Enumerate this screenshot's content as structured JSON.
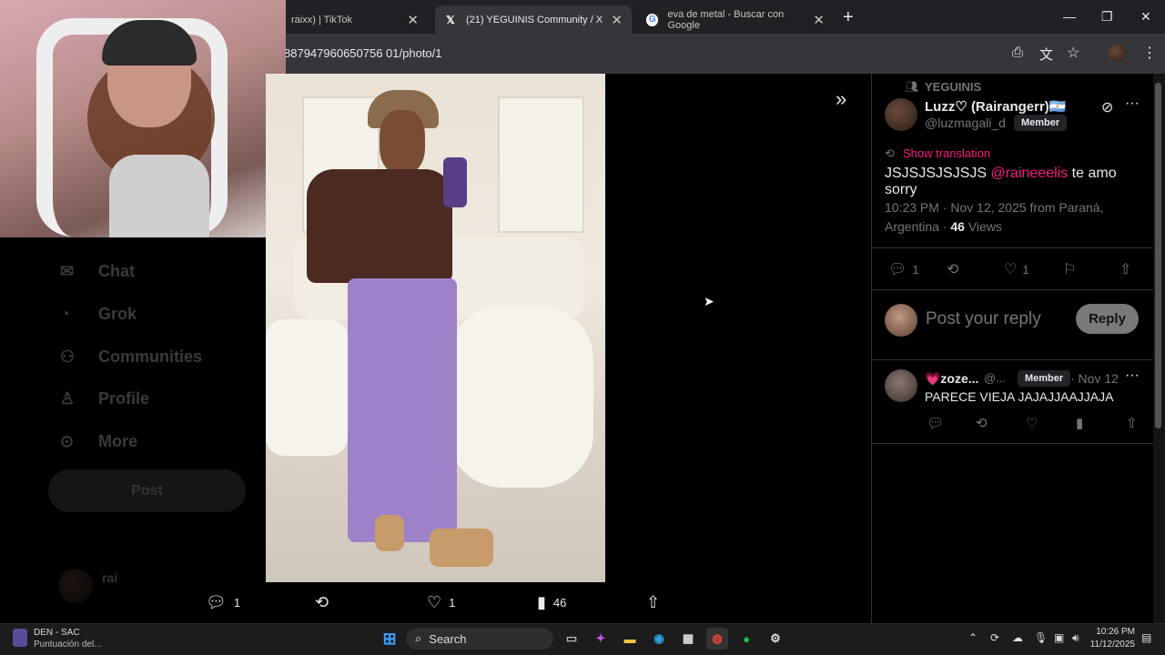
{
  "browser": {
    "tabs": [
      {
        "label": "raixx) | TikTok"
      },
      {
        "label": "(21) YEGUINIS Community / X"
      },
      {
        "label": "eva de metal - Buscar con Google"
      }
    ],
    "new_tab": "+",
    "url": "887947960650756 01/photo/1"
  },
  "left_nav": {
    "items": [
      "Chat",
      "Grok",
      "Communities",
      "Profile",
      "More"
    ],
    "post_label": "Post",
    "account": "rai"
  },
  "photo_actions": {
    "replies": "1",
    "likes": "1",
    "views": "46"
  },
  "tweet": {
    "community": "YEGUINIS",
    "display_name": "Luzz♡ (Rairangerr)🇦🇷",
    "handle": "@luzmagali_d",
    "member_badge": "Member",
    "show_translation": "Show translation",
    "text_before": "JSJSJSJSJSJS",
    "mention": "@raineeelis",
    "text_after": "te amo sorry",
    "time_location": "10:23 PM · Nov 12, 2025 from Paraná, Argentina ·",
    "views_count": "46",
    "views_label": "Views",
    "reply_count": "1",
    "like_count": "1"
  },
  "composer": {
    "placeholder": "Post your reply",
    "reply_label": "Reply"
  },
  "reply": {
    "name": "💗zoze...",
    "handle": "@...",
    "member_badge": "Member",
    "date": "· Nov 12",
    "text": "PARECE VIEJA JAJAJJAAJJAJA"
  },
  "taskbar": {
    "stream_title": "DEN - SAC",
    "stream_sub": "Puntuación del...",
    "search_label": "Search",
    "time": "10:26 PM",
    "date": "11/12/2025"
  }
}
